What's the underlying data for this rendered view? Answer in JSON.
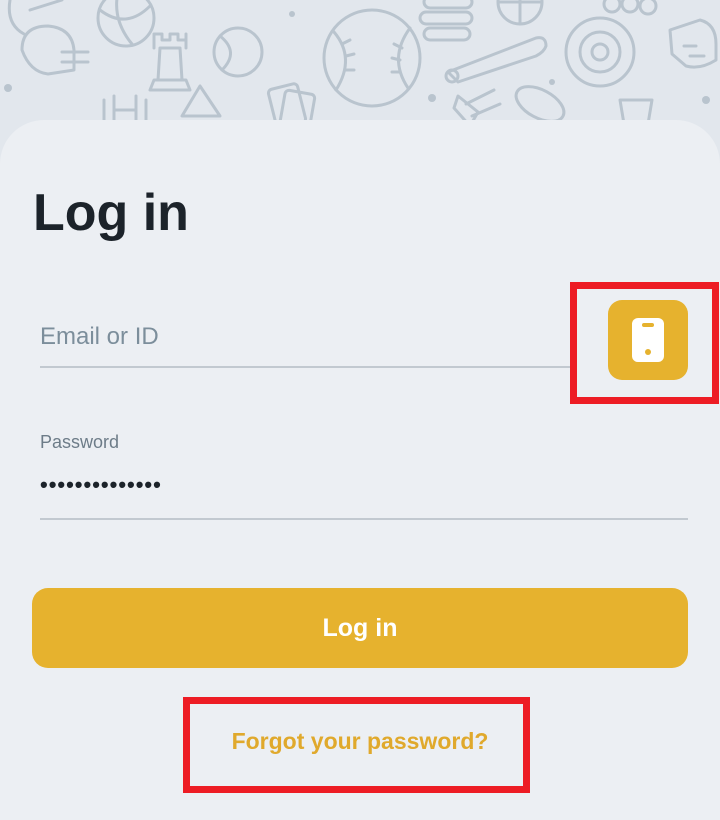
{
  "header": {
    "title": "Log in"
  },
  "email_field": {
    "placeholder": "Email or ID",
    "value": ""
  },
  "phone_toggle": {
    "icon": "smartphone-icon",
    "color": "#e6b22e"
  },
  "password_field": {
    "label": "Password",
    "value": "••••••••••••••"
  },
  "login_button": {
    "label": "Log in"
  },
  "forgot_link": {
    "label": "Forgot your password?"
  },
  "colors": {
    "accent": "#e6b22e",
    "background": "#e2e7ed",
    "card": "#eceff3",
    "highlight": "#ed1c24",
    "title_text": "#1c232a"
  }
}
